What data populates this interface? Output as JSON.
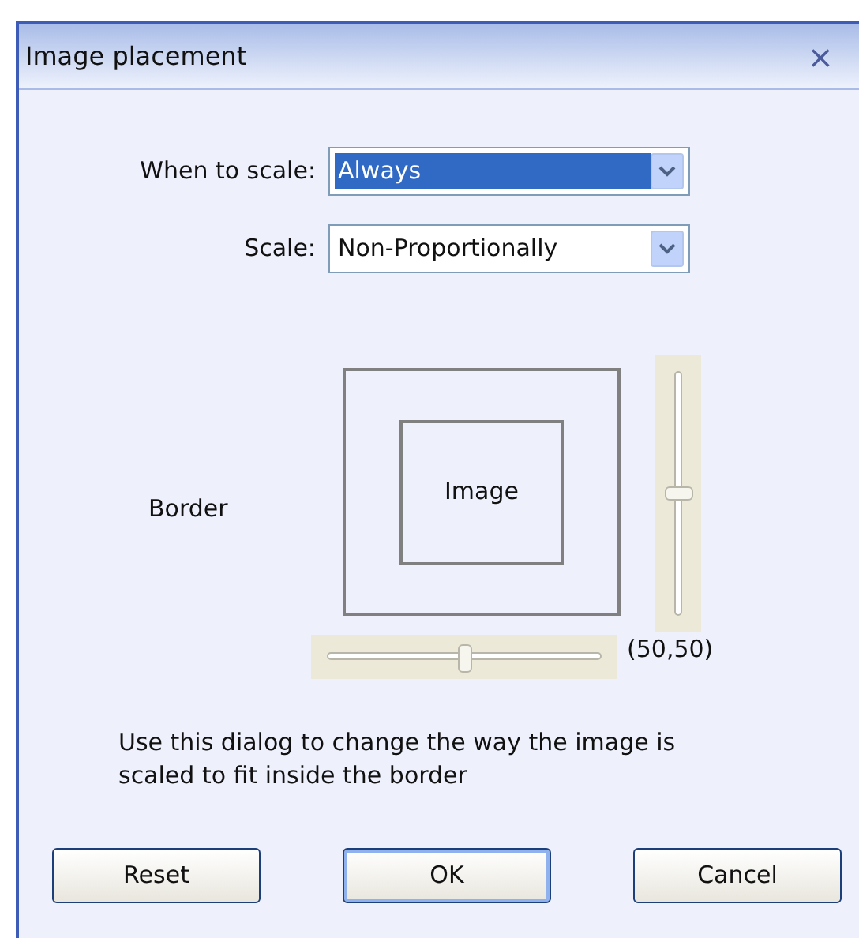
{
  "window": {
    "title": "Image placement",
    "close": "×"
  },
  "fields": [
    {
      "label": "When to scale:",
      "value": "Always",
      "highlighted": true
    },
    {
      "label": "Scale:",
      "value": "Non-Proportionally",
      "highlighted": false
    }
  ],
  "border": {
    "label": "Border",
    "image_label": "Image",
    "vertical_slider": {
      "level": 0.5
    },
    "horizontal_slider": {
      "level": 0.5
    },
    "reading": "(50,50)"
  },
  "description": "Use this dialog to change the way the image is scaled to fit inside the border",
  "buttons": [
    {
      "label": "Reset",
      "default": false
    },
    {
      "label": "OK",
      "default": true
    },
    {
      "label": "Cancel",
      "default": false
    }
  ]
}
